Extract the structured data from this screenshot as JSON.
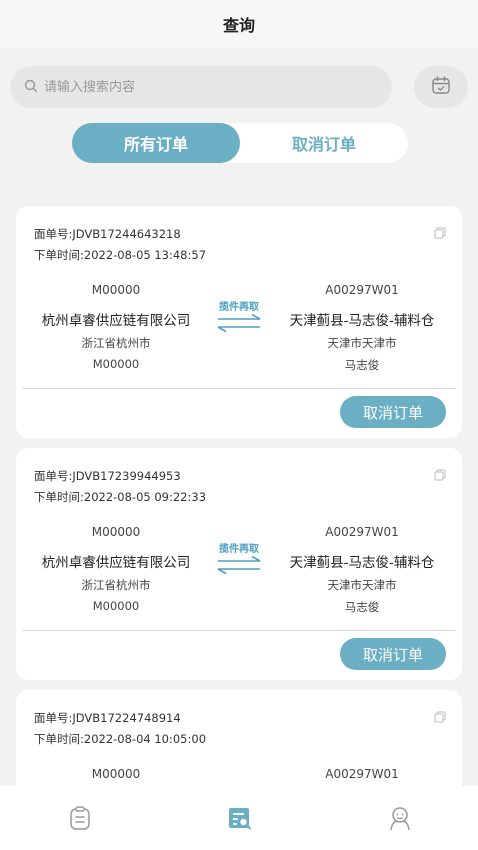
{
  "header": {
    "title": "查询"
  },
  "search": {
    "placeholder": "请输入搜索内容"
  },
  "segment": {
    "all_label": "所有订单",
    "cancelled_label": "取消订单"
  },
  "orders": [
    {
      "waybill": "面单号:JDVB17244643218",
      "time": "下单时间:2022-08-05 13:48:57",
      "sender": {
        "code": "M00000",
        "name": "杭州卓睿供应链有限公司",
        "city": "浙江省杭州市",
        "contact": "M00000"
      },
      "receiver": {
        "code": "A00297W01",
        "name": "天津蓟县-马志俊-辅料仓",
        "city": "天津市天津市",
        "contact": "马志俊"
      },
      "transfer_label": "揽件再取",
      "cancel_label": "取消订单"
    },
    {
      "waybill": "面单号:JDVB17239944953",
      "time": "下单时间:2022-08-05 09:22:33",
      "sender": {
        "code": "M00000",
        "name": "杭州卓睿供应链有限公司",
        "city": "浙江省杭州市",
        "contact": "M00000"
      },
      "receiver": {
        "code": "A00297W01",
        "name": "天津蓟县-马志俊-辅料仓",
        "city": "天津市天津市",
        "contact": "马志俊"
      },
      "transfer_label": "揽件再取",
      "cancel_label": "取消订单"
    },
    {
      "waybill": "面单号:JDVB17224748914",
      "time": "下单时间:2022-08-04 10:05:00",
      "sender": {
        "code": "M00000"
      },
      "receiver": {
        "code": "A00297W01"
      }
    }
  ],
  "colors": {
    "accent": "#6aafc4",
    "link": "#4a9fc3",
    "background": "#f2f2f2"
  },
  "tabbar": {
    "items": [
      "clipboard-icon",
      "search-list-icon",
      "user-icon"
    ],
    "active": "search-list-icon"
  }
}
